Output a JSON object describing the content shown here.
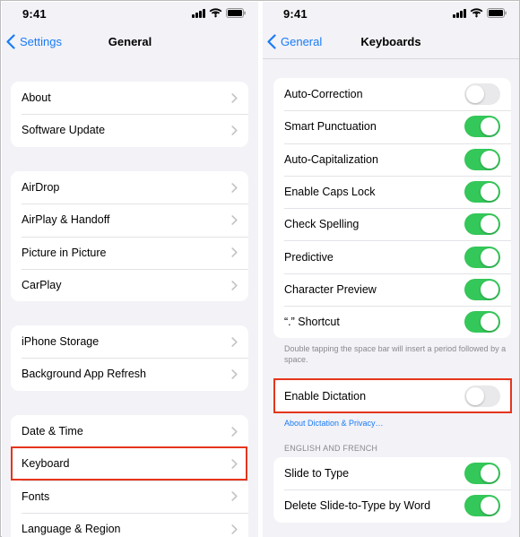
{
  "left": {
    "status_time": "9:41",
    "back_label": "Settings",
    "title": "General",
    "groups": [
      [
        "About",
        "Software Update"
      ],
      [
        "AirDrop",
        "AirPlay & Handoff",
        "Picture in Picture",
        "CarPlay"
      ],
      [
        "iPhone Storage",
        "Background App Refresh"
      ],
      [
        "Date & Time",
        "Keyboard",
        "Fonts",
        "Language & Region"
      ]
    ],
    "highlighted_item": "Keyboard"
  },
  "right": {
    "status_time": "9:41",
    "back_label": "General",
    "title": "Keyboards",
    "toggles": [
      {
        "label": "Auto-Correction",
        "on": false
      },
      {
        "label": "Smart Punctuation",
        "on": true
      },
      {
        "label": "Auto-Capitalization",
        "on": true
      },
      {
        "label": "Enable Caps Lock",
        "on": true
      },
      {
        "label": "Check Spelling",
        "on": true
      },
      {
        "label": "Predictive",
        "on": true
      },
      {
        "label": "Character Preview",
        "on": true
      },
      {
        "label": "“.” Shortcut",
        "on": true
      }
    ],
    "shortcut_footnote": "Double tapping the space bar will insert a period followed by a space.",
    "dictation": {
      "label": "Enable Dictation",
      "on": false
    },
    "dictation_link": "About Dictation & Privacy…",
    "section_header": "ENGLISH AND FRENCH",
    "language_toggles": [
      {
        "label": "Slide to Type",
        "on": true
      },
      {
        "label": "Delete Slide-to-Type by Word",
        "on": true
      }
    ]
  },
  "colors": {
    "accent": "#1a7bf5",
    "toggle_on": "#34c759",
    "toggle_off": "#e9e9eb",
    "highlight": "#e5351c",
    "background": "#f2f2f7"
  }
}
